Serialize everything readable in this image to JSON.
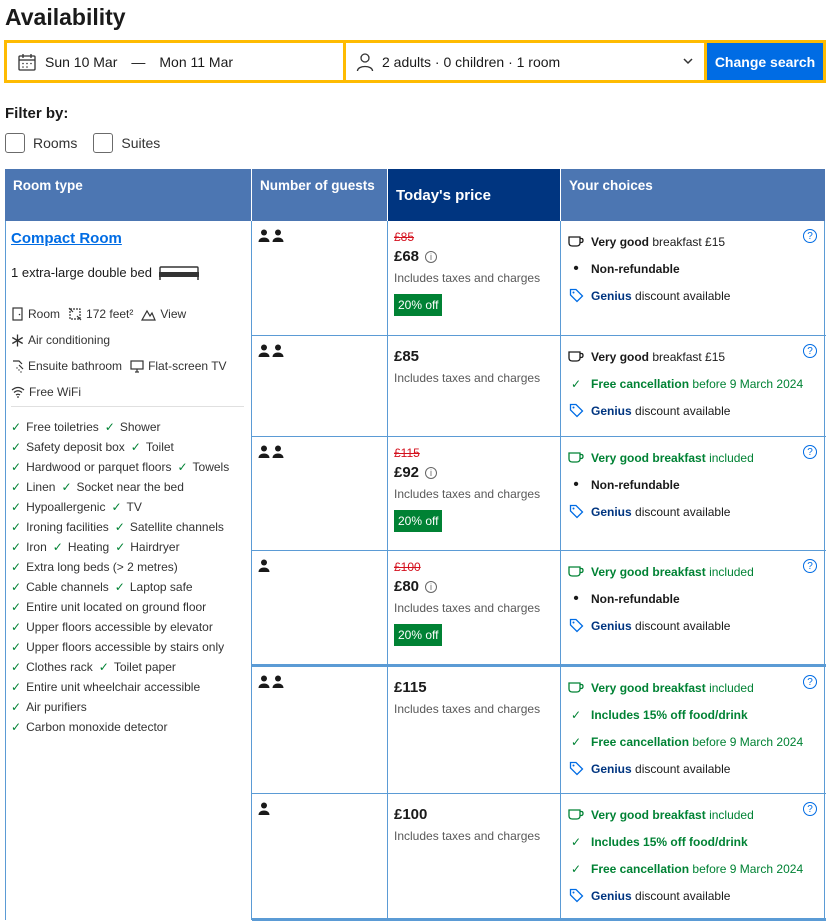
{
  "page": {
    "title": "Availability"
  },
  "search": {
    "check_in": "Sun 10 Mar",
    "check_out": "Mon 11 Mar",
    "date_separator": "—",
    "guests": "2 adults · 0 children · 1 room",
    "button_label": "Change search"
  },
  "filters": {
    "label": "Filter by:",
    "options": [
      "Rooms",
      "Suites"
    ]
  },
  "table": {
    "headers": {
      "room_type": "Room type",
      "guests": "Number of guests",
      "price": "Today's price",
      "choices": "Your choices"
    }
  },
  "room": {
    "name": "Compact Room",
    "bed": "1 extra-large double bed",
    "facilities": {
      "room": "Room",
      "size": "172 feet²",
      "view": "View",
      "ac": "Air conditioning",
      "bath": "Ensuite bathroom",
      "tv": "Flat-screen TV",
      "wifi": "Free WiFi"
    },
    "amenity_rows": [
      [
        "Free toiletries",
        "Shower"
      ],
      [
        "Safety deposit box",
        "Toilet"
      ],
      [
        "Hardwood or parquet floors",
        "Towels"
      ],
      [
        "Linen",
        "Socket near the bed"
      ],
      [
        "Hypoallergenic",
        "TV"
      ],
      [
        "Ironing facilities",
        "Satellite channels"
      ],
      [
        "Iron",
        "Heating",
        "Hairdryer"
      ],
      [
        "Extra long beds (> 2 metres)"
      ],
      [
        "Cable channels",
        "Laptop safe"
      ],
      [
        "Entire unit located on ground floor"
      ],
      [
        "Upper floors accessible by elevator"
      ],
      [
        "Upper floors accessible by stairs only"
      ],
      [
        "Clothes rack",
        "Toilet paper"
      ],
      [
        "Entire unit wheelchair accessible"
      ],
      [
        "Air purifiers"
      ],
      [
        "Carbon monoxide detector"
      ]
    ]
  },
  "common": {
    "tax_note": "Includes taxes and charges",
    "breakfast_quality": "Very good",
    "breakfast_word": "breakfast",
    "breakfast_paid": "breakfast £15",
    "breakfast_included": "included",
    "non_refundable": "Non-refundable",
    "free_cancel": "Free cancellation",
    "cancel_date": "before 9 March 2024",
    "genius": "Genius",
    "genius_rest": "discount available",
    "food_discount": "Includes 15% off food/drink"
  },
  "offers": [
    {
      "persons": 2,
      "old_price": "£85",
      "price": "£68",
      "badge": "20% off"
    },
    {
      "persons": 2,
      "old_price": "",
      "price": "£85",
      "badge": ""
    },
    {
      "persons": 2,
      "old_price": "£115",
      "price": "£92",
      "badge": "20% off"
    },
    {
      "persons": 1,
      "old_price": "£100",
      "price": "£80",
      "badge": "20% off"
    },
    {
      "persons": 2,
      "old_price": "",
      "price": "£115",
      "badge": ""
    },
    {
      "persons": 1,
      "old_price": "",
      "price": "£100",
      "badge": ""
    }
  ],
  "colors": {
    "header": "#4c76b2",
    "price_header": "#003580",
    "accent": "#006ce4",
    "green": "#008234",
    "strike": "#d4111e",
    "search_border": "#febb02"
  }
}
